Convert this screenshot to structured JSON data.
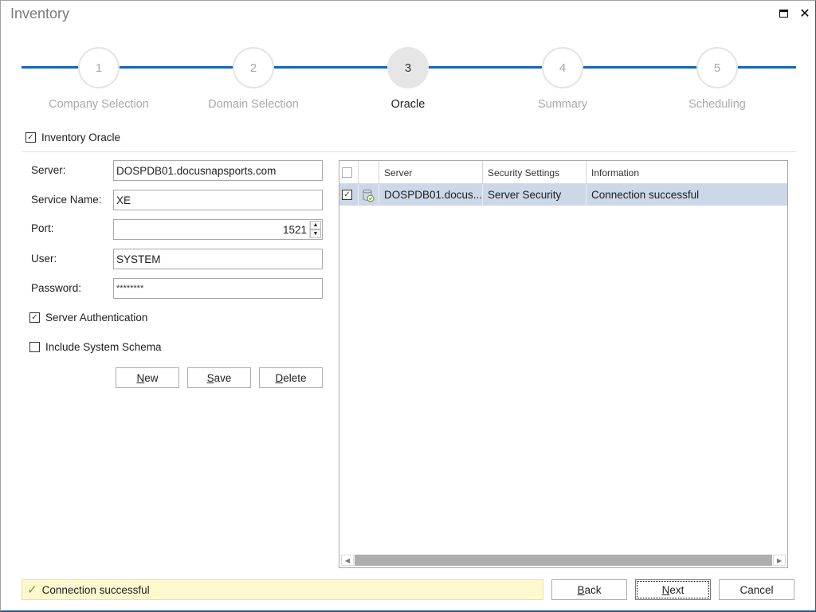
{
  "window": {
    "title": "Inventory",
    "maximize_icon": "maximize-icon",
    "close_icon": "close-icon",
    "close_glyph": "✕"
  },
  "stepper": {
    "accent_color": "#1565c0",
    "current_step": 3,
    "steps": [
      {
        "number": "1",
        "label": "Company Selection"
      },
      {
        "number": "2",
        "label": "Domain Selection"
      },
      {
        "number": "3",
        "label": "Oracle"
      },
      {
        "number": "4",
        "label": "Summary"
      },
      {
        "number": "5",
        "label": "Scheduling"
      }
    ]
  },
  "inventory_oracle": {
    "label": "Inventory Oracle",
    "checked": true,
    "check_glyph": "✓"
  },
  "form": {
    "server_label": "Server:",
    "server_value": "DOSPDB01.docusnapsports.com",
    "service_name_label": "Service Name:",
    "service_name_value": "XE",
    "port_label": "Port:",
    "port_value": "1521",
    "port_up": "▲",
    "port_down": "▼",
    "user_label": "User:",
    "user_value": "SYSTEM",
    "password_label": "Password:",
    "password_value": "********",
    "server_auth": {
      "label": "Server Authentication",
      "checked": true,
      "check_glyph": "✓"
    },
    "include_system_schema": {
      "label": "Include System Schema",
      "checked": false,
      "check_glyph": ""
    },
    "buttons": {
      "new": {
        "mnemonic": "N",
        "rest": "ew"
      },
      "save": {
        "mnemonic": "S",
        "rest": "ave"
      },
      "delete": {
        "mnemonic": "D",
        "rest": "elete"
      }
    }
  },
  "grid": {
    "columns": [
      "",
      "",
      "Server",
      "Security Settings",
      "Information"
    ],
    "rows": [
      {
        "checked": true,
        "check_glyph": "✓",
        "icon": "database-connected-icon",
        "server": "DOSPDB01.docus...",
        "security_settings": "Server Security",
        "information": "Connection successful"
      }
    ],
    "scroll_left": "◀",
    "scroll_right": "▶"
  },
  "status": {
    "icon": "check-icon",
    "glyph": "✓",
    "text": "Connection successful",
    "color": "#6aa52a"
  },
  "footer": {
    "back": {
      "mnemonic": "B",
      "rest": "ack"
    },
    "next": {
      "mnemonic": "N",
      "rest": "ext"
    },
    "cancel": {
      "label": "Cancel"
    }
  }
}
